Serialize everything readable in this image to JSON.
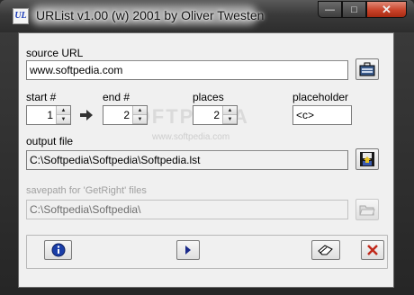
{
  "window": {
    "title": "URList v1.00 (w) 2001 by Oliver Twesten",
    "app_icon_text": "UL"
  },
  "source": {
    "label": "source URL",
    "value": "www.softpedia.com"
  },
  "range": {
    "start_label": "start #",
    "start_value": "1",
    "end_label": "end #",
    "end_value": "2",
    "places_label": "places",
    "places_value": "2",
    "placeholder_label": "placeholder",
    "placeholder_value": "<c>"
  },
  "output": {
    "label": "output file",
    "value": "C:\\Softpedia\\Softpedia\\Softpedia.lst"
  },
  "savepath": {
    "label": "savepath for 'GetRight' files",
    "value": "C:\\Softpedia\\Softpedia\\"
  },
  "watermark": {
    "text": "SOFTPEDIA",
    "url": "www.softpedia.com"
  },
  "colors": {
    "info_icon": "#1a3ea8",
    "close_x": "#c0281a"
  }
}
